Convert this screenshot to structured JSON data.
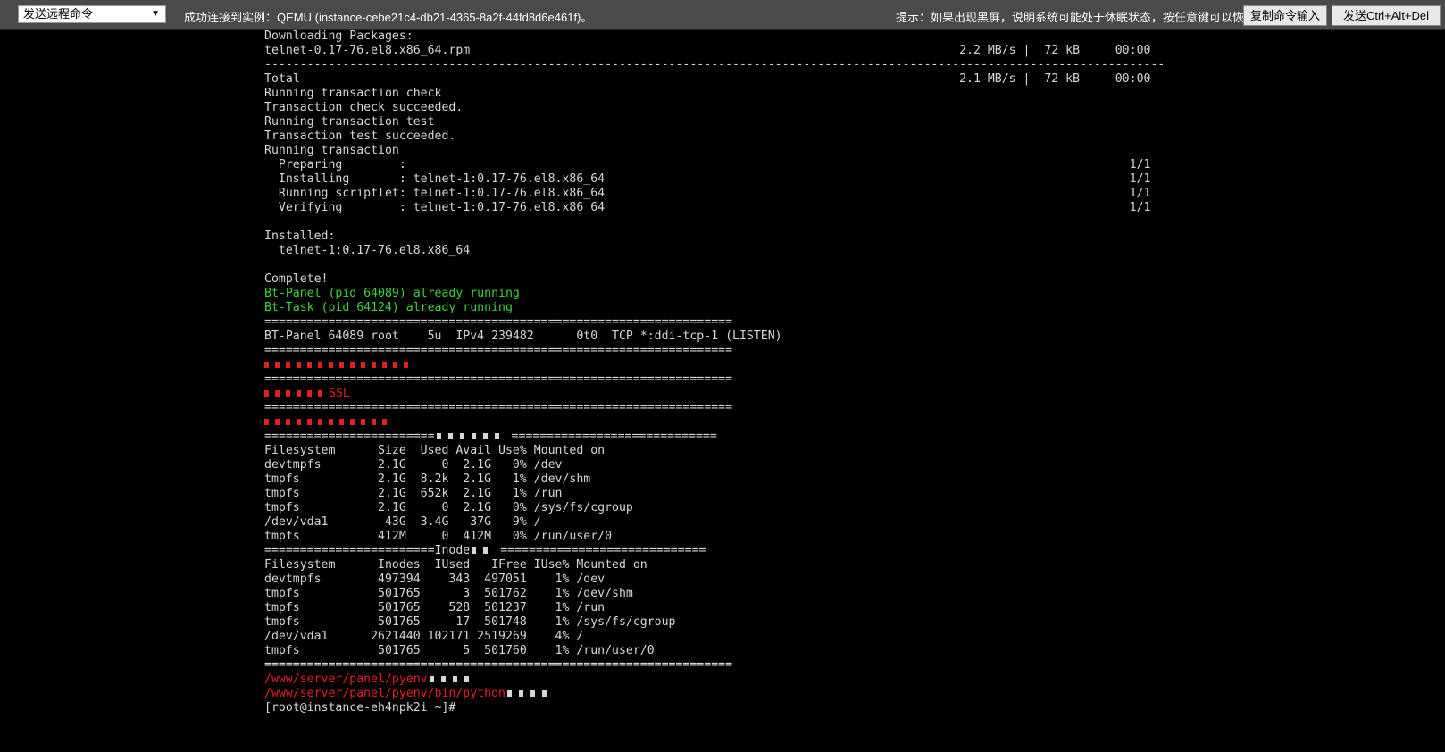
{
  "toolbar": {
    "command_select": "发送远程命令",
    "status_text": "成功连接到实例：QEMU (instance-cebe21c4-db21-4365-8a2f-44fd8d6e461f)。",
    "hint_text": "提示：如果出现黑屏，说明系统可能处于休眠状态，按任意键可以恢复。",
    "copy_button": "复制命令输入",
    "cad_button": "发送Ctrl+Alt+Del"
  },
  "terminal": {
    "l01": "Downloading Packages:",
    "l02": "telnet-0.17-76.el8.x86_64.rpm                                                                     2.2 MB/s |  72 kB     00:00",
    "l03": "-------------------------------------------------------------------------------------------------------------------------------",
    "l04": "Total                                                                                             2.1 MB/s |  72 kB     00:00",
    "l05": "Running transaction check",
    "l06": "Transaction check succeeded.",
    "l07": "Running transaction test",
    "l08": "Transaction test succeeded.",
    "l09": "Running transaction",
    "l10": "  Preparing        :                                                                                                      1/1",
    "l11": "  Installing       : telnet-1:0.17-76.el8.x86_64                                                                          1/1",
    "l12": "  Running scriptlet: telnet-1:0.17-76.el8.x86_64                                                                          1/1",
    "l13": "  Verifying        : telnet-1:0.17-76.el8.x86_64                                                                          1/1",
    "l14": "",
    "l15": "Installed:",
    "l16": "  telnet-1:0.17-76.el8.x86_64",
    "l17": "",
    "l18": "Complete!",
    "l19": "Bt-Panel (pid 64089) already running",
    "l20": "Bt-Task (pid 64124) already running",
    "l21": "==================================================================",
    "l22": "BT-Panel 64089 root    5u  IPv4 239482      0t0  TCP *:ddi-tcp-1 (LISTEN)",
    "l23": "==================================================================",
    "l25": "==================================================================",
    "l26": "SSL",
    "l27": "==================================================================",
    "l29a": "========================",
    "l29b": "=============================",
    "l30": "Filesystem      Size  Used Avail Use% Mounted on",
    "l31": "devtmpfs        2.1G     0  2.1G   0% /dev",
    "l32": "tmpfs           2.1G  8.2k  2.1G   1% /dev/shm",
    "l33": "tmpfs           2.1G  652k  2.1G   1% /run",
    "l34": "tmpfs           2.1G     0  2.1G   0% /sys/fs/cgroup",
    "l35": "/dev/vda1        43G  3.4G   37G   9% /",
    "l36": "tmpfs           412M     0  412M   0% /run/user/0",
    "l37a": "========================Inode",
    "l37b": "=============================",
    "l38": "Filesystem      Inodes  IUsed   IFree IUse% Mounted on",
    "l39": "devtmpfs        497394    343  497051    1% /dev",
    "l40": "tmpfs           501765      3  501762    1% /dev/shm",
    "l41": "tmpfs           501765    528  501237    1% /run",
    "l42": "tmpfs           501765     17  501748    1% /sys/fs/cgroup",
    "l43": "/dev/vda1      2621440 102171 2519269    4% /",
    "l44": "tmpfs           501765      5  501760    1% /run/user/0",
    "l45": "==================================================================",
    "l46": "/www/server/panel/pyenv",
    "l47": "/www/server/panel/pyenv/bin/python",
    "l48": "[root@instance-eh4npk2i ~]#"
  }
}
